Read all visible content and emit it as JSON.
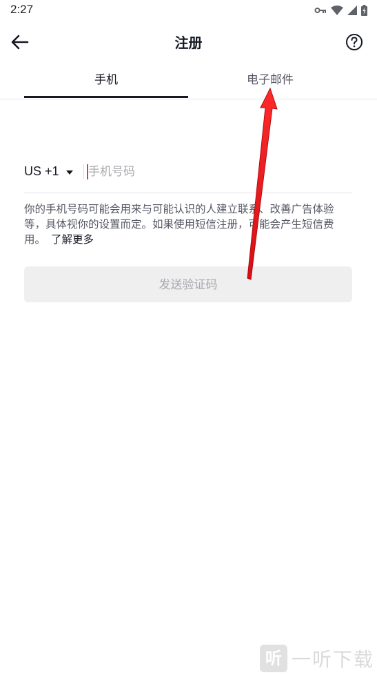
{
  "status_bar": {
    "time": "2:27",
    "icons": [
      "key-icon",
      "wifi-icon",
      "signal-icon",
      "battery-icon"
    ]
  },
  "header": {
    "title": "注册",
    "back_icon": "back-arrow-icon",
    "help_icon": "help-icon"
  },
  "tabs": [
    {
      "label": "手机",
      "active": true
    },
    {
      "label": "电子邮件",
      "active": false
    }
  ],
  "phone": {
    "country_code": "US +1",
    "placeholder": "手机号码",
    "value": ""
  },
  "notice": {
    "text": "你的手机号码可能会用来与可能认识的人建立联系、改善广告体验等，具体视你的设置而定。如果使用短信注册，可能会产生短信费用。",
    "link": "了解更多"
  },
  "send_button": {
    "label": "发送验证码"
  },
  "watermark": {
    "glyph": "听",
    "text": "一听下载"
  },
  "colors": {
    "accent": "#fe2c55",
    "text": "#161823",
    "disabled": "#a8a9ae",
    "annotation_arrow": "#e8141b"
  }
}
